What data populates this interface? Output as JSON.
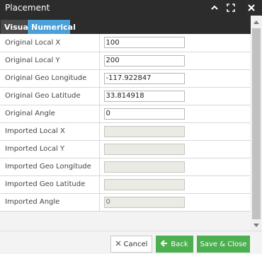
{
  "window": {
    "title": "Placement"
  },
  "tabs": [
    {
      "label": "Visual"
    },
    {
      "label": "Numerical"
    }
  ],
  "fields": [
    {
      "label": "Original Local X",
      "value": "100",
      "editable": true
    },
    {
      "label": "Original Local Y",
      "value": "200",
      "editable": true
    },
    {
      "label": "Original Geo Longitude",
      "value": "-117.922847",
      "editable": true
    },
    {
      "label": "Original Geo Latitude",
      "value": "33.814918",
      "editable": true
    },
    {
      "label": "Original Angle",
      "value": "0",
      "editable": true
    },
    {
      "label": "Imported Local X",
      "value": "",
      "editable": false
    },
    {
      "label": "Imported Local Y",
      "value": "",
      "editable": false
    },
    {
      "label": "Imported Geo Longitude",
      "value": "",
      "editable": false
    },
    {
      "label": "Imported Geo Latitude",
      "value": "",
      "editable": false
    },
    {
      "label": "Imported Angle",
      "value": "0",
      "editable": false
    }
  ],
  "footer": {
    "cancel_label": "Cancel",
    "back_label": "Back",
    "save_close_label": "Save & Close"
  },
  "colors": {
    "tab_active": "#4aa0d8",
    "primary_button": "#4caf50",
    "titlebar": "#2c2c2c"
  },
  "icons": [
    "collapse-up-icon",
    "maximize-icon",
    "close-icon",
    "x-icon",
    "arrow-left-icon",
    "scroll-up-icon",
    "scroll-down-icon"
  ]
}
